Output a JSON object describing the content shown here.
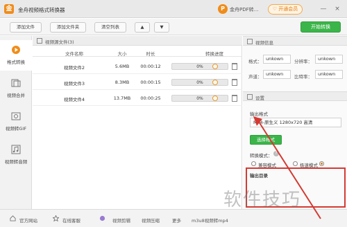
{
  "titlebar": {
    "app_title": "金舟视频格式转换器",
    "app_logo_char": "金",
    "ad_logo_char": "P",
    "ad_text": "金舟PDF转...",
    "vip_label": "♡ 开通会员",
    "minimize": "—",
    "close": "×"
  },
  "toolbar": {
    "add_file": "添加文件",
    "add_folder": "添加文件夹",
    "clear_list": "清空列表",
    "up_arrow": "▲",
    "down_arrow": "▼",
    "start": "开始转换"
  },
  "sidebar": {
    "items": [
      {
        "label": "格式转换",
        "icon": "video-convert-icon",
        "active": true
      },
      {
        "label": "视频合并",
        "icon": "video-merge-icon",
        "active": false
      },
      {
        "label": "视频转GIF",
        "icon": "video-gif-icon",
        "active": false
      },
      {
        "label": "视频转音频",
        "icon": "video-audio-icon",
        "active": false
      }
    ]
  },
  "filelist": {
    "header": "视频源文件(3)",
    "columns": [
      "文件名称",
      "大小",
      "时长",
      "转换进度",
      "操作"
    ],
    "rows": [
      {
        "name": "视频文件2",
        "size": "5.6MB",
        "duration": "00:00:12",
        "progress": "0%"
      },
      {
        "name": "视频文件3",
        "size": "8.3MB",
        "duration": "00:00:15",
        "progress": "0%"
      },
      {
        "name": "视频文件4",
        "size": "13.7MB",
        "duration": "00:00:25",
        "progress": "0%"
      }
    ]
  },
  "info": {
    "header": "视频信息",
    "format_label": "格式：",
    "format_value": "unkown",
    "resolution_label": "分辨率：",
    "resolution_value": "unkown",
    "channel_label": "声道：",
    "channel_value": "unkown",
    "bitrate_label": "比特率：",
    "bitrate_value": "unkown"
  },
  "settings": {
    "header": "设置",
    "output_format_label": "输出格式",
    "output_format_value": "MP4-原生义 1280x720 高清",
    "select_format": "选择格式",
    "mode_label": "转换模式：",
    "mode_help": "?",
    "mode_compat": "兼容模式",
    "mode_fast": "极速模式",
    "outdir_label": "输出目录"
  },
  "bottombar": {
    "website": "官方网站",
    "online_service": "在线客服",
    "video_clip": "视频剪辑",
    "video_compress": "视频压缩",
    "more": "更多",
    "extra": "m3u8视频转mp4"
  },
  "watermark": "软件技巧",
  "colors": {
    "accent_green": "#3bb54a",
    "brand_orange": "#f08c1a",
    "highlight_red": "#d43a32"
  }
}
